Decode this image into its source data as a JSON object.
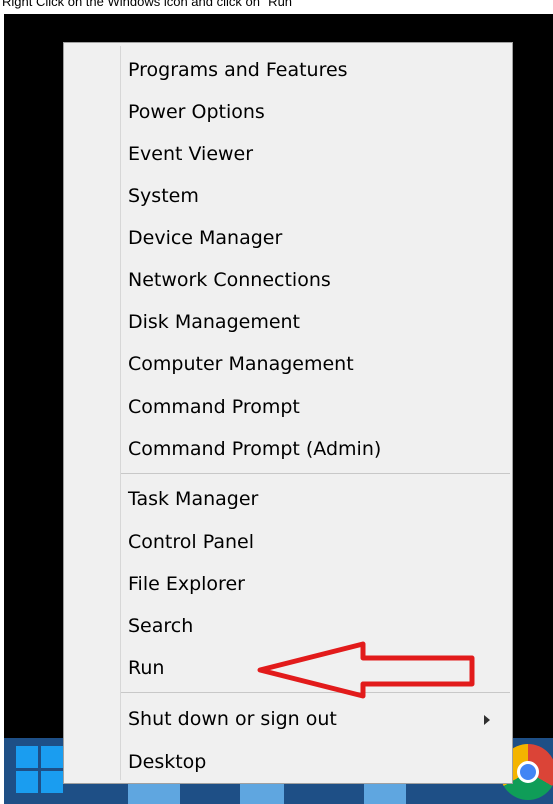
{
  "caption": "Right Click on the Windows icon and click on \"Run\"",
  "menu": {
    "group1": [
      "Programs and Features",
      "Power Options",
      "Event Viewer",
      "System",
      "Device Manager",
      "Network Connections",
      "Disk Management",
      "Computer Management",
      "Command Prompt",
      "Command Prompt (Admin)"
    ],
    "group2": [
      "Task Manager",
      "Control Panel",
      "File Explorer",
      "Search",
      "Run"
    ],
    "group3": [
      "Shut down or sign out",
      "Desktop"
    ]
  },
  "icons": {
    "start": "windows-start-icon",
    "browser": "chrome-icon",
    "submenu": "chevron-right-icon",
    "annotation": "red-arrow-icon"
  },
  "colors": {
    "menu_background": "#f0f0f0",
    "desktop_background": "#000000",
    "taskbar": "#1e4f86",
    "annotation_arrow": "#e21b1b",
    "start_logo": "#1a9df0"
  }
}
